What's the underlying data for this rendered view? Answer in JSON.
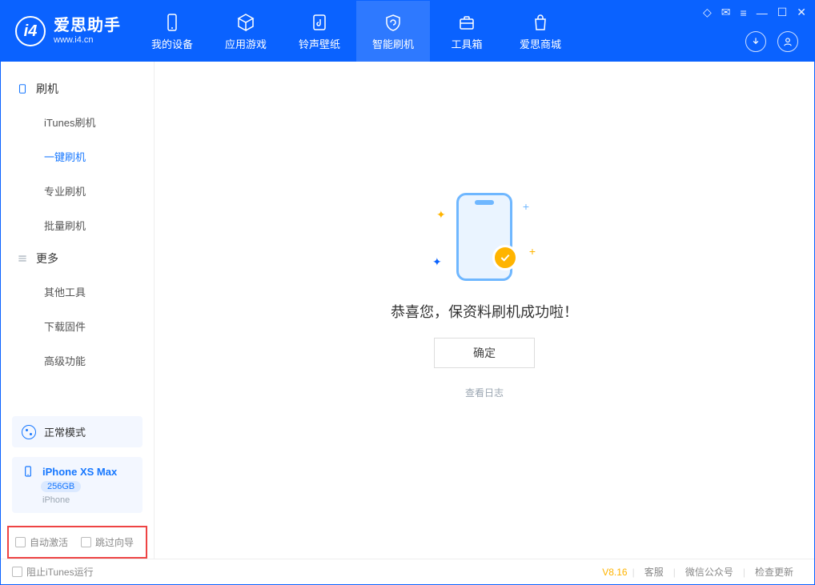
{
  "app": {
    "name_cn": "爱思助手",
    "name_en": "www.i4.cn"
  },
  "nav": {
    "items": [
      {
        "label": "我的设备"
      },
      {
        "label": "应用游戏"
      },
      {
        "label": "铃声壁纸"
      },
      {
        "label": "智能刷机"
      },
      {
        "label": "工具箱"
      },
      {
        "label": "爱思商城"
      }
    ]
  },
  "sidebar": {
    "section1": {
      "title": "刷机",
      "items": [
        {
          "label": "iTunes刷机"
        },
        {
          "label": "一键刷机"
        },
        {
          "label": "专业刷机"
        },
        {
          "label": "批量刷机"
        }
      ]
    },
    "section2": {
      "title": "更多",
      "items": [
        {
          "label": "其他工具"
        },
        {
          "label": "下载固件"
        },
        {
          "label": "高级功能"
        }
      ]
    },
    "mode": {
      "label": "正常模式"
    },
    "device": {
      "name": "iPhone XS Max",
      "capacity": "256GB",
      "type": "iPhone"
    },
    "checkboxes": {
      "auto_activate": "自动激活",
      "skip_guide": "跳过向导"
    }
  },
  "main": {
    "success_text": "恭喜您，保资料刷机成功啦！",
    "ok_button": "确定",
    "view_log": "查看日志"
  },
  "statusbar": {
    "block_itunes": "阻止iTunes运行",
    "version": "V8.16",
    "support": "客服",
    "wechat": "微信公众号",
    "update": "检查更新"
  }
}
